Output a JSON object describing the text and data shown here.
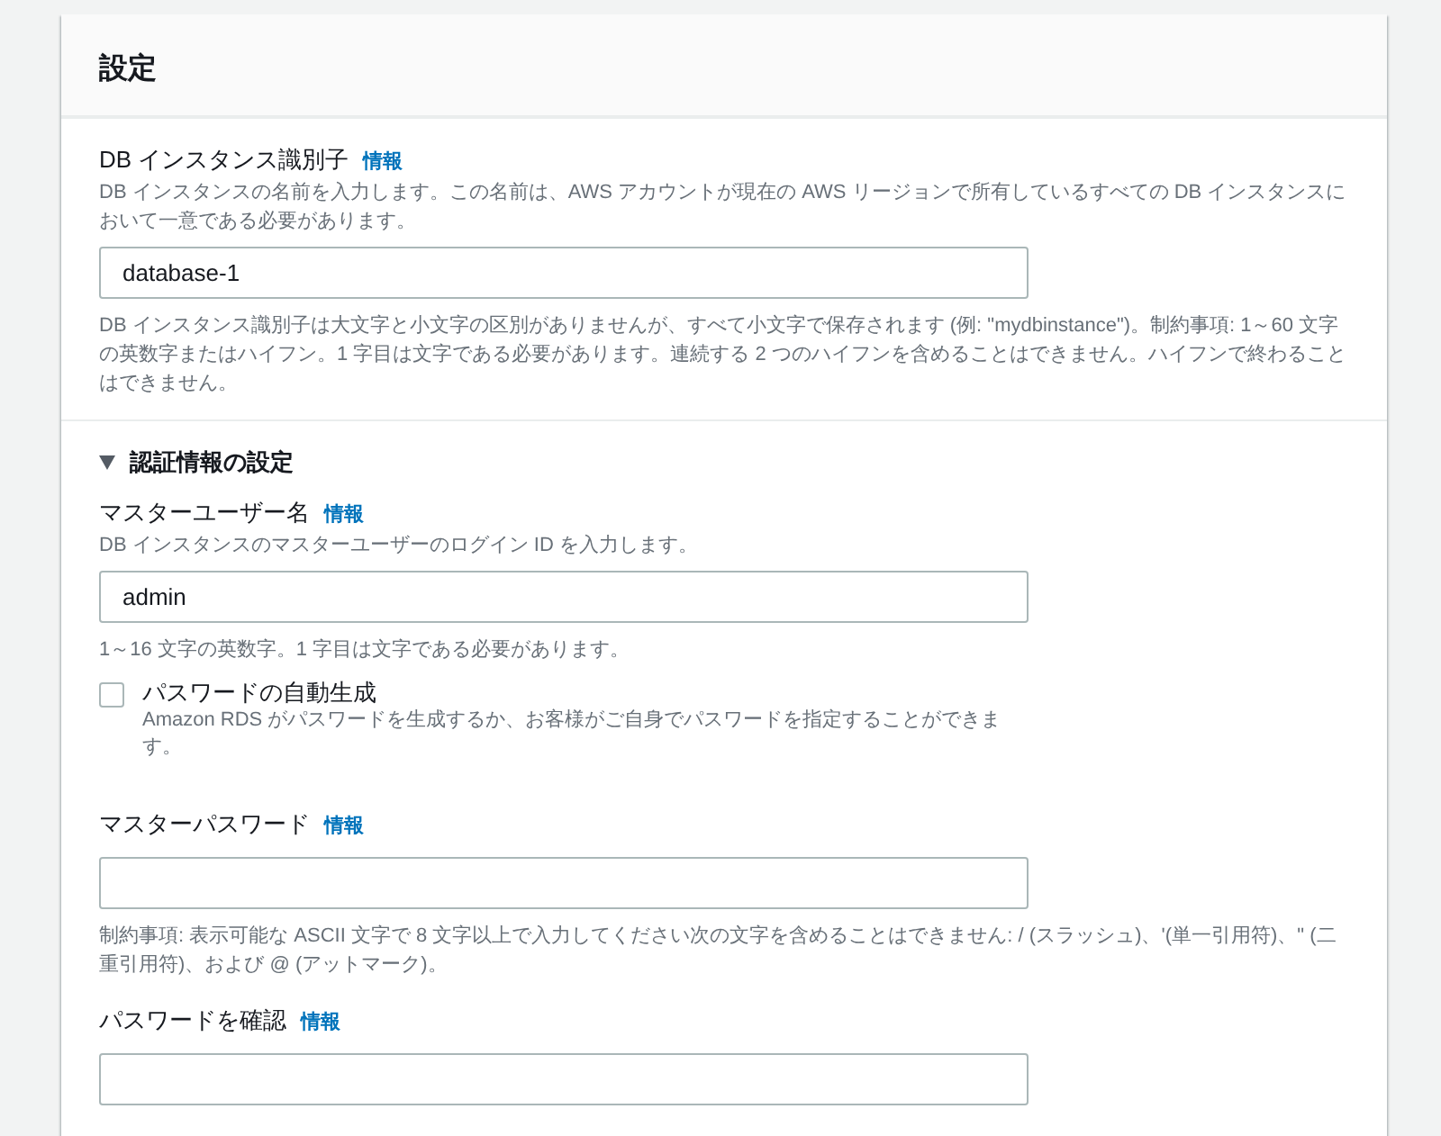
{
  "panel": {
    "title": "設定"
  },
  "sections": [
    {
      "kind": "plain",
      "fields": [
        {
          "kind": "text",
          "label": "DB インスタンス識別子",
          "info": "情報",
          "description": "DB インスタンスの名前を入力します。この名前は、AWS アカウントが現在の AWS リージョンで所有しているすべての DB インスタンスにおいて一意である必要があります。",
          "value": "database-1",
          "hint": "DB インスタンス識別子は大文字と小文字の区別がありませんが、すべて小文字で保存されます (例: \"mydbinstance\")。制約事項: 1～60 文字の英数字またはハイフン。1 字目は文字である必要があります。連続する 2 つのハイフンを含めることはできません。ハイフンで終わることはできません。"
        }
      ]
    },
    {
      "kind": "expandable",
      "title": "認証情報の設定",
      "expanded": true,
      "fields": [
        {
          "kind": "text",
          "label": "マスターユーザー名",
          "info": "情報",
          "description": "DB インスタンスのマスターユーザーのログイン ID を入力します。",
          "value": "admin",
          "hint": "1～16 文字の英数字。1 字目は文字である必要があります。"
        },
        {
          "kind": "checkbox",
          "label": "パスワードの自動生成",
          "checked": false,
          "description": "Amazon RDS がパスワードを生成するか、お客様がご自身でパスワードを指定することができます。"
        },
        {
          "kind": "text",
          "label": "マスターパスワード",
          "info": "情報",
          "hint": "制約事項: 表示可能な ASCII 文字で 8 文字以上で入力してください次の文字を含めることはできません: / (スラッシュ)、'(単一引用符)、\" (二重引用符)、および @ (アットマーク)。"
        },
        {
          "kind": "text",
          "label": "パスワードを確認",
          "info": "情報"
        }
      ]
    }
  ]
}
